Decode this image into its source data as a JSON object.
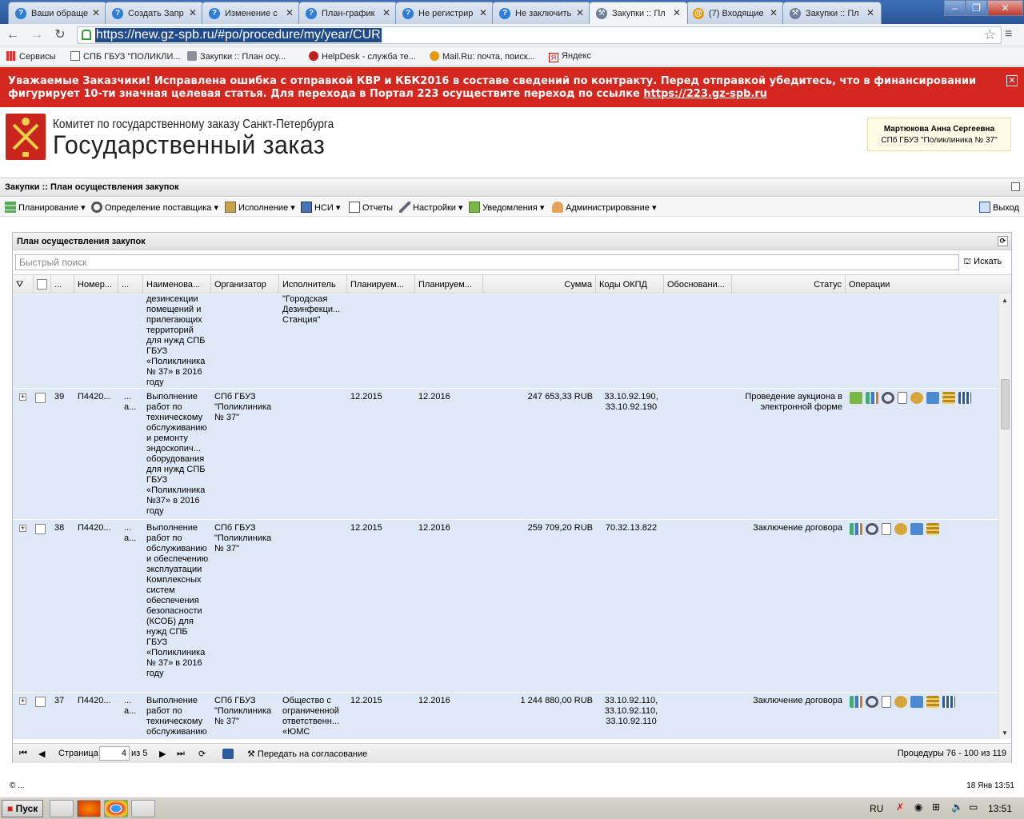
{
  "browser": {
    "tabs": [
      {
        "label": "Ваши обраще",
        "icon": "help-icon"
      },
      {
        "label": "Создать Запр",
        "icon": "help-icon"
      },
      {
        "label": "Изменение с",
        "icon": "help-icon"
      },
      {
        "label": "План-график",
        "icon": "help-icon"
      },
      {
        "label": "Не регистрир",
        "icon": "help-icon"
      },
      {
        "label": "Не заключить",
        "icon": "help-icon"
      },
      {
        "label": "Закупки :: Пл",
        "icon": "hammer-icon",
        "active": true
      },
      {
        "label": "(7) Входящие",
        "icon": "mail-icon"
      },
      {
        "label": "Закупки :: Пл",
        "icon": "hammer-icon"
      }
    ],
    "url": "https://new.gz-spb.ru/#po/procedure/my/year/CUR",
    "bookmarks": [
      {
        "label": "Сервисы"
      },
      {
        "label": "СПБ ГБУЗ \"ПОЛИКЛИ..."
      },
      {
        "label": "Закупки :: План осу..."
      },
      {
        "label": "HelpDesk - служба те..."
      },
      {
        "label": "Mail.Ru: почта, поиск..."
      },
      {
        "label": "Яндекс"
      }
    ]
  },
  "banner": {
    "text": "Уважаемые Заказчики! Исправлена ошибка с отправкой КВР и КБК2016 в составе сведений по контракту. Перед отправкой убедитесь, что в финансировании фигурирует 10-ти значная целевая статья. Для перехода в Портал 223 осуществите переход по ссылке",
    "link": "https://223.gz-spb.ru",
    "close": "✕"
  },
  "header": {
    "org_line1": "Комитет по государственному заказу Санкт-Петербурга",
    "org_line2": "Государственный заказ",
    "user_name": "Мартюкова Анна Сергеевна",
    "user_org": "СПб ГБУЗ \"Поликлиника № 37\""
  },
  "app": {
    "title": "Закупки :: План осуществления закупок",
    "menu": [
      "Планирование",
      "Определение поставщика",
      "Исполнение",
      "НСИ",
      "Отчеты",
      "Настройки",
      "Уведомления",
      "Администрирование"
    ],
    "logout": "Выход"
  },
  "panel": {
    "title": "План осуществления закупок",
    "search_placeholder": "Быстрый поиск",
    "search_button": "Искать",
    "columns": [
      "...",
      "Номер...",
      "...",
      "Наименова...",
      "Организатор",
      "Исполнитель",
      "Планируем...",
      "Планируем...",
      "Сумма",
      "Коды ОКПД",
      "Обосновани...",
      "Статус",
      "Операции"
    ],
    "partial_row": {
      "name": "дезинсекции помещений и прилегающих территорий для нужд СПБ ГБУЗ «Поликлиника № 37» в 2016 году",
      "executor": "\"Городская Дезинфекци... Станция\""
    },
    "rows": [
      {
        "num": "39",
        "number": "П4420...",
        "dots1": "...",
        "dots2": "а...",
        "name": "Выполнение работ по техническому обслуживанию и ремонту эндоскопич... оборудования для нужд СПБ ГБУЗ «Поликлиника №37» в 2016 году",
        "organizer": "СПб ГБУЗ \"Поликлиника № 37\"",
        "executor": "",
        "plan1": "12.2015",
        "plan2": "12.2016",
        "sum": "247 653,33 RUB",
        "okpd": "33.10.92.190, 33.10.92.190",
        "basis": "",
        "status": "Проведение аукциона в электронной форме"
      },
      {
        "num": "38",
        "number": "П4420...",
        "dots1": "...",
        "dots2": "а...",
        "name": "Выполнение работ по обслуживанию и обеспечению эксплуатации Комплексных систем обеспечения безопасности (КСОБ) для нужд СПБ ГБУЗ «Поликлиника № 37» в 2016 году",
        "organizer": "СПб ГБУЗ \"Поликлиника № 37\"",
        "executor": "",
        "plan1": "12.2015",
        "plan2": "12.2016",
        "sum": "259 709,20 RUB",
        "okpd": "70.32.13.822",
        "basis": "",
        "status": "Заключение договора"
      },
      {
        "num": "37",
        "number": "П4420...",
        "dots1": "...",
        "dots2": "а...",
        "name": "Выполнение работ по техническому обслуживанию и ремонту",
        "organizer": "СПб ГБУЗ \"Поликлиника № 37\"",
        "executor": "Общество с ограниченной ответственн... «ЮМС сервис»",
        "plan1": "12.2015",
        "plan2": "12.2016",
        "sum": "1 244 880,00 RUB",
        "okpd": "33.10.92.110, 33.10.92.110, 33.10.92.110",
        "basis": "",
        "status": "Заключение договора"
      }
    ],
    "pager": {
      "page_label": "Страница",
      "page_value": "4",
      "of_label": "из 5",
      "action": "Передать на согласование",
      "summary": "Процедуры 76 - 100 из 119"
    }
  },
  "statusbar": {
    "left": "© ...",
    "right": "18 Янв 13:51"
  },
  "taskbar": {
    "start": "Пуск",
    "lang": "RU",
    "clock": "13:51"
  },
  "colors": {
    "banner_bg": "#d4271f",
    "row_bg": "#dfe8f6",
    "tab_bar": "#2b5797"
  }
}
